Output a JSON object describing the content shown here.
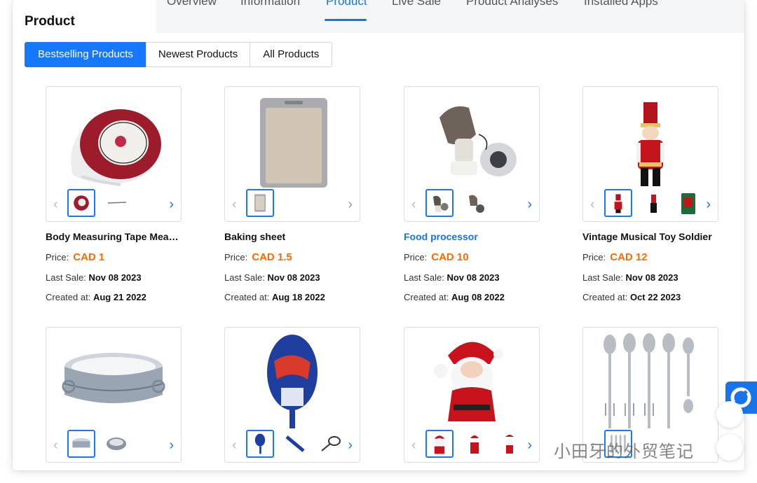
{
  "header": {
    "title": "Product",
    "tabs": [
      {
        "label": "Overview",
        "active": false
      },
      {
        "label": "Information",
        "active": false
      },
      {
        "label": "Product",
        "active": true
      },
      {
        "label": "Live Sale",
        "active": false
      },
      {
        "label": "Product Analyses",
        "active": false
      },
      {
        "label": "Installed Apps",
        "active": false
      }
    ]
  },
  "filters": [
    {
      "label": "Bestselling Products",
      "active": true
    },
    {
      "label": "Newest Products",
      "active": false
    },
    {
      "label": "All Products",
      "active": false
    }
  ],
  "labels": {
    "price": "Price:",
    "last_sale": "Last Sale:",
    "created_at": "Created at:"
  },
  "products": [
    {
      "name": "Body Measuring Tape Meas...",
      "price": "CAD 1",
      "last_sale": "Nov 08 2023",
      "created": "Aug 21 2022",
      "link": false
    },
    {
      "name": "Baking sheet",
      "price": "CAD 1.5",
      "last_sale": "Nov 08 2023",
      "created": "Aug 18 2022",
      "link": false
    },
    {
      "name": "Food processor",
      "price": "CAD 10",
      "last_sale": "Nov 08 2023",
      "created": "Aug 08 2022",
      "link": true
    },
    {
      "name": "Vintage Musical Toy Soldier",
      "price": "CAD 12",
      "last_sale": "Nov 08 2023",
      "created": "Oct 22 2023",
      "link": false
    }
  ],
  "watermark": "小田牙的外贸笔记",
  "colors": {
    "accent": "#1677ff",
    "price": "#ff6a00",
    "link": "#1a73e8"
  }
}
